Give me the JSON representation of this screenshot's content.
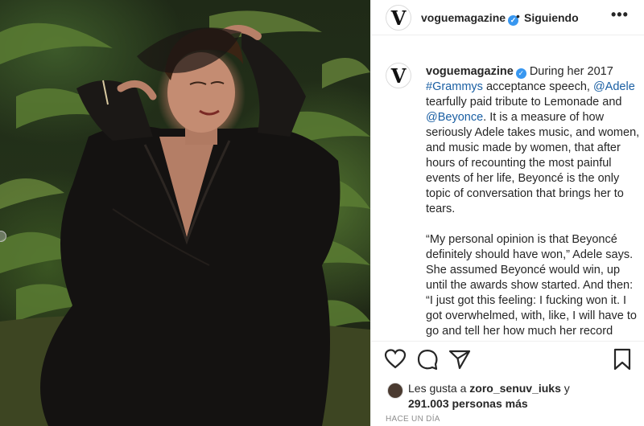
{
  "post": {
    "username": "voguemagazine",
    "avatar_letter": "V",
    "separator": "•",
    "follow_status": "Siguiendo",
    "more_label": "•••",
    "verified_mark": "✓",
    "nav_dot": "",
    "caption": {
      "username": "voguemagazine",
      "p1_a": "During her 2017",
      "p1_link1": "#Grammys",
      "p1_b": "acceptance speech,",
      "p1_link2": "@Adele",
      "p1_c": "tearfully paid tribute to Lemonade and",
      "p1_link3": "@Beyonce",
      "p1_d": ". It is a measure of how seriously Adele takes music, and women, and music made by women, that after hours of recounting the most painful events of her life, Beyoncé is the only topic of conversation that brings her to tears.",
      "p2": "“My personal opinion is that Beyoncé definitely should have won,” Adele says. She assumed Beyoncé would win, up until the awards show started. And then: “I just got this feeling: I fucking won it. I got overwhelmed, with, like, I will have to go and tell her how much her record means to me.” Adele’s voice starts to"
    },
    "likes": {
      "prefix": "Les gusta a",
      "user": "zoro_senuv_iuks",
      "and": "y",
      "count_text": "291.003 personas más"
    },
    "timestamp": "HACE UN DÍA"
  },
  "icons": {
    "like": "heart-icon",
    "comment": "comment-icon",
    "share": "paper-plane-icon",
    "save": "bookmark-icon",
    "more": "more-options-icon"
  },
  "colors": {
    "link": "#1a5fa3",
    "verified": "#3897f0",
    "muted": "#8e8e8e"
  }
}
